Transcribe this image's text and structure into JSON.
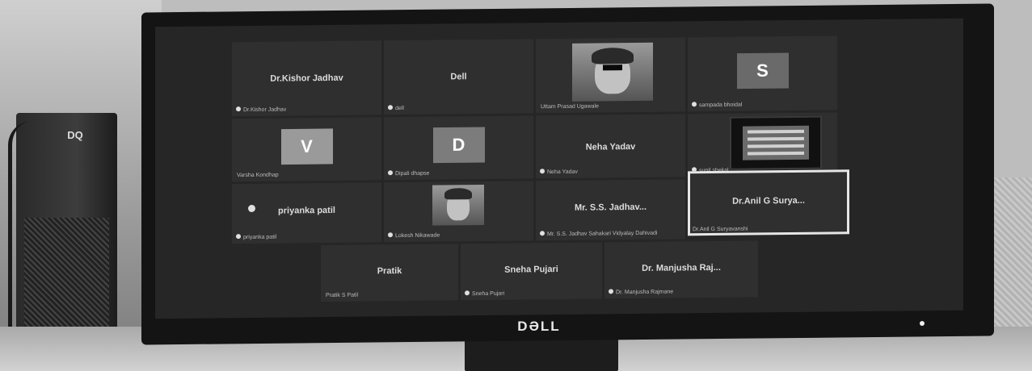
{
  "monitor": {
    "brand": "DƏLL"
  },
  "pc": {
    "logo": "DQ"
  },
  "participants": [
    {
      "name": "Dr.Kishor Jadhav",
      "caption": "Dr.Kishor Jadhav",
      "avatar_letter": "",
      "color": "#2f2f2f"
    },
    {
      "name": "Dell",
      "caption": "dell",
      "avatar_letter": "",
      "color": "#2f2f2f"
    },
    {
      "name": "",
      "caption": "Uttam Prasad Ugawale",
      "avatar_letter": "",
      "color": "#2f2f2f"
    },
    {
      "name": "",
      "caption": "sampada bhoidal",
      "avatar_letter": "S",
      "color": "#6a6a6a"
    },
    {
      "name": "",
      "caption": "Varsha Kondhap",
      "avatar_letter": "V",
      "color": "#9a9a9a"
    },
    {
      "name": "",
      "caption": "Dipali dhapse",
      "avatar_letter": "D",
      "color": "#7c7c7c"
    },
    {
      "name": "Neha Yadav",
      "caption": "Neha Yadav",
      "avatar_letter": "",
      "color": "#2f2f2f"
    },
    {
      "name": "",
      "caption": "sunil shekal",
      "avatar_letter": "",
      "color": "#2f2f2f"
    },
    {
      "name": "priyanka patil",
      "caption": "priyanka patil",
      "avatar_letter": "",
      "color": "#2f2f2f"
    },
    {
      "name": "",
      "caption": "Lokesh Nikawade",
      "avatar_letter": "",
      "color": "#2f2f2f"
    },
    {
      "name": "Mr. S.S. Jadhav...",
      "caption": "Mr. S.S. Jadhav Sahakari Vidyalay Dahivadi",
      "avatar_letter": "",
      "color": "#2f2f2f"
    },
    {
      "name": "Dr.Anil G Surya...",
      "caption": "Dr.Anil G Suryavanshi",
      "avatar_letter": "",
      "color": "#2f2f2f"
    },
    {
      "name": "Pratik",
      "caption": "Pratik S Patil",
      "avatar_letter": "",
      "color": "#2f2f2f"
    },
    {
      "name": "Sneha Pujari",
      "caption": "Sneha Pujari",
      "avatar_letter": "",
      "color": "#2f2f2f"
    },
    {
      "name": "Dr. Manjusha Raj...",
      "caption": "Dr. Manjusha Rajmane",
      "avatar_letter": "",
      "color": "#2f2f2f"
    }
  ]
}
